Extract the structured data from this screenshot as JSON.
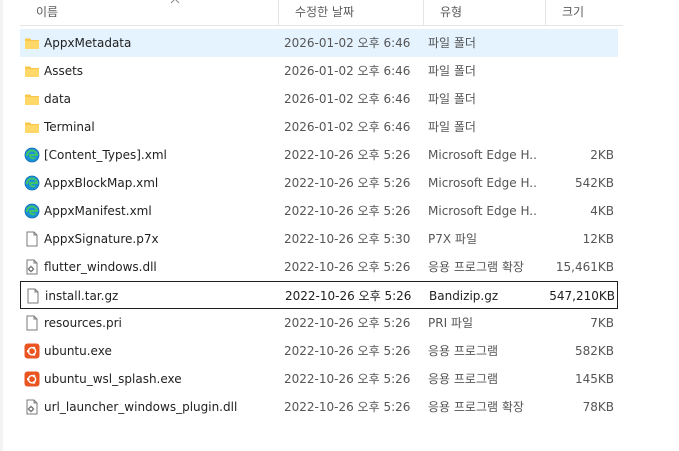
{
  "columns": {
    "name": "이름",
    "date": "수정한 날짜",
    "type": "유형",
    "size": "크기"
  },
  "files": [
    {
      "name": "AppxMetadata",
      "date": "2026-01-02 오후 6:46",
      "type": "파일 폴더",
      "size": "",
      "icon": "folder-icon"
    },
    {
      "name": "Assets",
      "date": "2026-01-02 오후 6:46",
      "type": "파일 폴더",
      "size": "",
      "icon": "folder-icon"
    },
    {
      "name": "data",
      "date": "2026-01-02 오후 6:46",
      "type": "파일 폴더",
      "size": "",
      "icon": "folder-icon"
    },
    {
      "name": "Terminal",
      "date": "2026-01-02 오후 6:46",
      "type": "파일 폴더",
      "size": "",
      "icon": "folder-icon"
    },
    {
      "name": "[Content_Types].xml",
      "date": "2022-10-26 오후 5:26",
      "type": "Microsoft Edge H...",
      "size": "2KB",
      "icon": "edge-icon"
    },
    {
      "name": "AppxBlockMap.xml",
      "date": "2022-10-26 오후 5:26",
      "type": "Microsoft Edge H...",
      "size": "542KB",
      "icon": "edge-icon"
    },
    {
      "name": "AppxManifest.xml",
      "date": "2022-10-26 오후 5:26",
      "type": "Microsoft Edge H...",
      "size": "4KB",
      "icon": "edge-icon"
    },
    {
      "name": "AppxSignature.p7x",
      "date": "2022-10-26 오후 5:30",
      "type": "P7X 파일",
      "size": "12KB",
      "icon": "file-icon"
    },
    {
      "name": "flutter_windows.dll",
      "date": "2022-10-26 오후 5:26",
      "type": "응용 프로그램 확장",
      "size": "15,461KB",
      "icon": "dll-icon"
    },
    {
      "name": "install.tar.gz",
      "date": "2022-10-26 오후 5:26",
      "type": "Bandizip.gz",
      "size": "547,210KB",
      "icon": "file-icon"
    },
    {
      "name": "resources.pri",
      "date": "2022-10-26 오후 5:26",
      "type": "PRI 파일",
      "size": "7KB",
      "icon": "file-icon"
    },
    {
      "name": "ubuntu.exe",
      "date": "2022-10-26 오후 5:26",
      "type": "응용 프로그램",
      "size": "582KB",
      "icon": "ubuntu-icon"
    },
    {
      "name": "ubuntu_wsl_splash.exe",
      "date": "2022-10-26 오후 5:26",
      "type": "응용 프로그램",
      "size": "145KB",
      "icon": "ubuntu-icon"
    },
    {
      "name": "url_launcher_windows_plugin.dll",
      "date": "2022-10-26 오후 5:26",
      "type": "응용 프로그램 확장",
      "size": "78KB",
      "icon": "dll-icon"
    }
  ],
  "hovered_index": 0,
  "selected_index": 9,
  "colors": {
    "folder": "#f8c74a",
    "hover_bg": "#e5f3ff",
    "edge": "#1b8fd8",
    "ubuntu": "#e95420"
  }
}
